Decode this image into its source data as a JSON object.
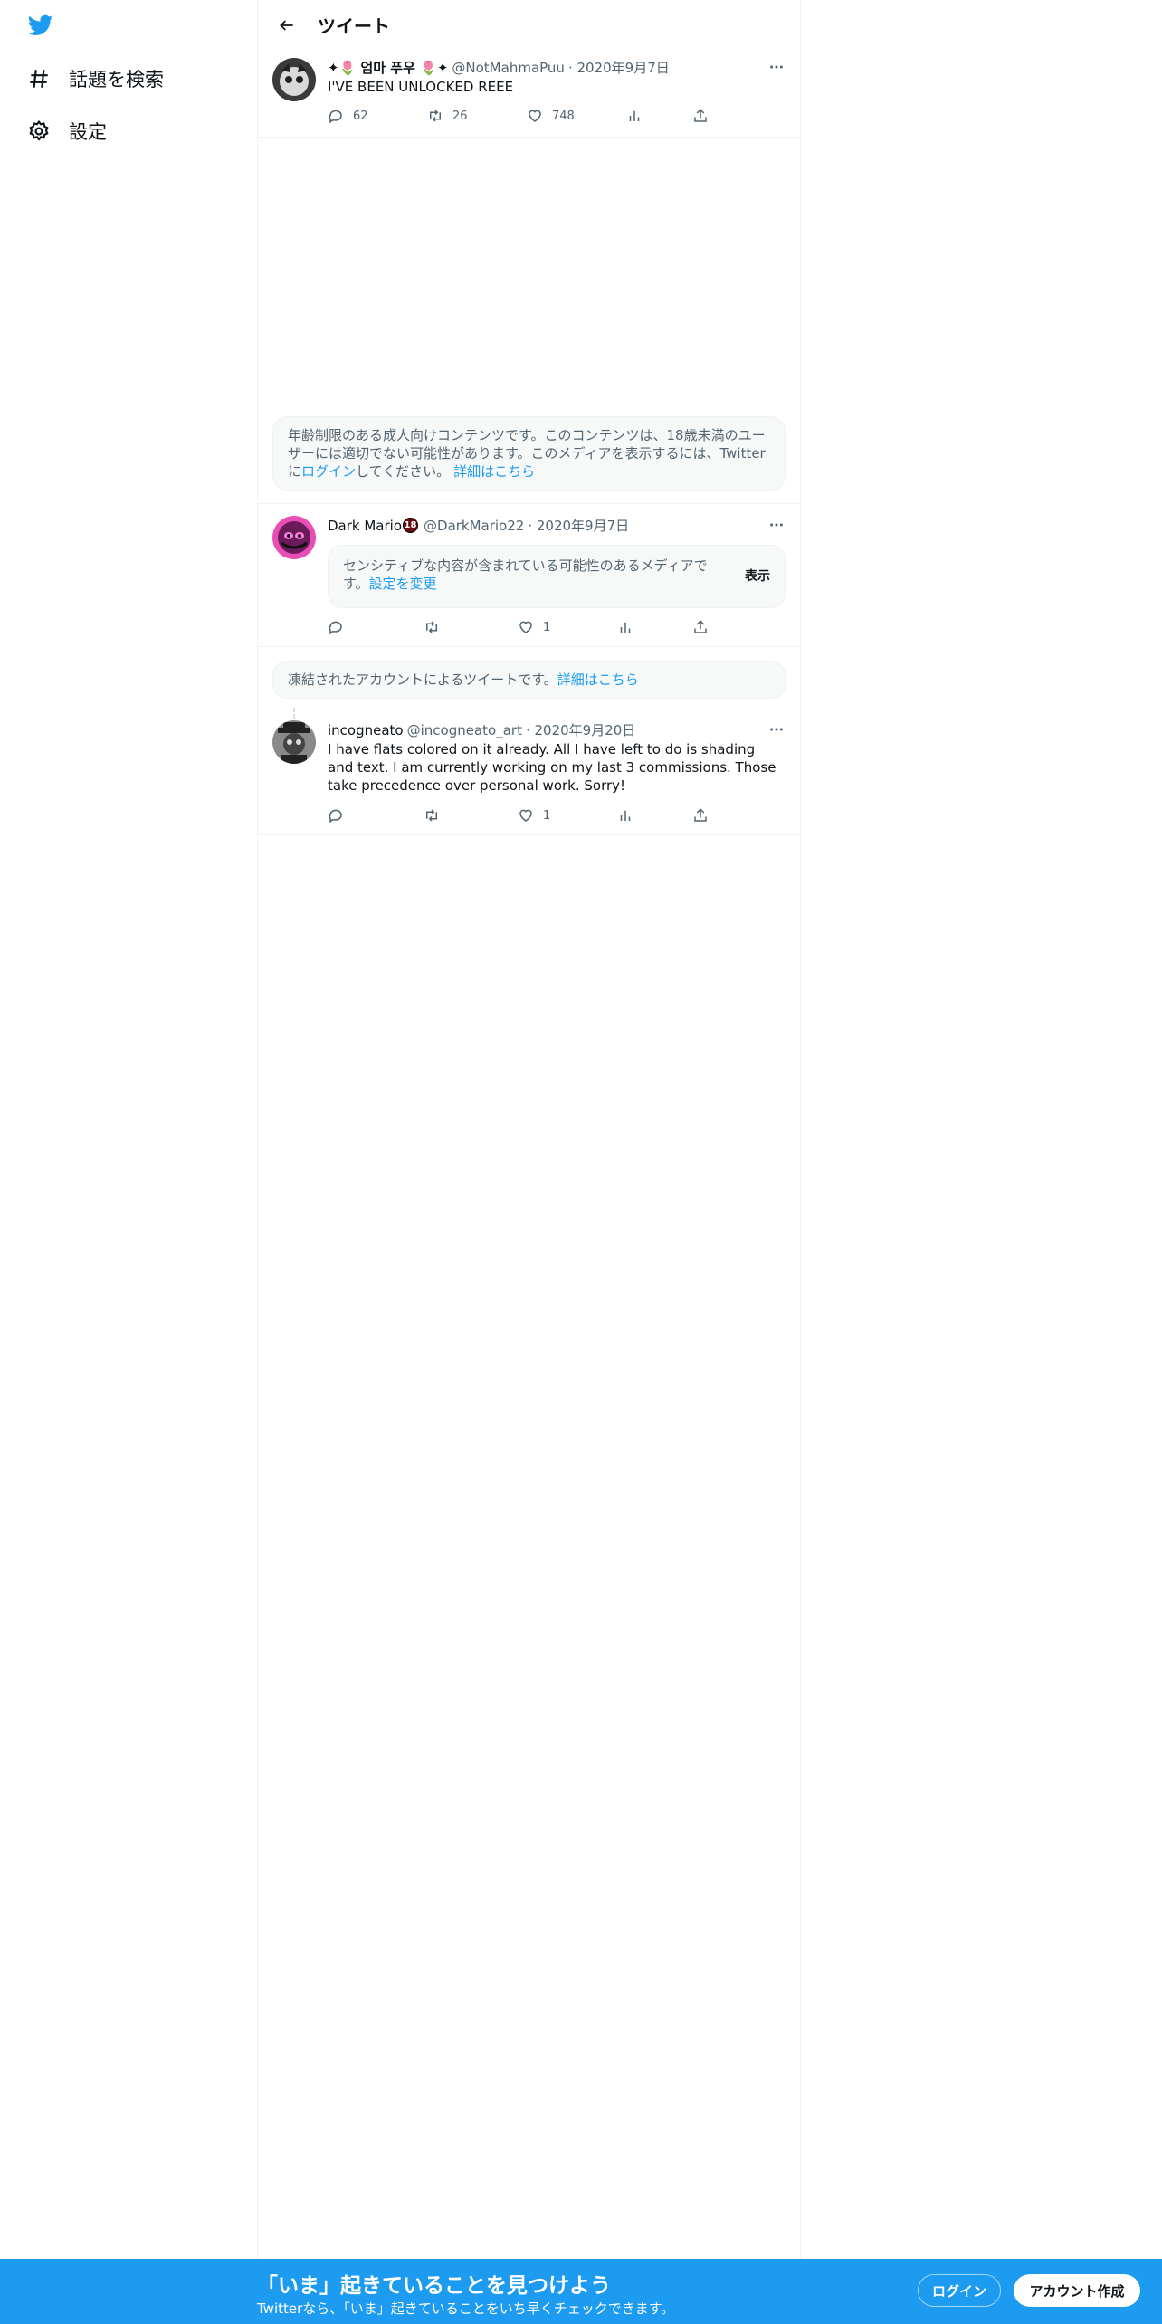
{
  "colors": {
    "brand": "#1d9bf0",
    "text": "#0f1419",
    "secondary": "#536471",
    "border": "#eff3f4"
  },
  "sidebar": {
    "logo_icon": "twitter-bird-icon",
    "items": [
      {
        "label": "話題を検索",
        "icon": "hashtag-icon"
      },
      {
        "label": "設定",
        "icon": "gear-icon"
      }
    ]
  },
  "header": {
    "title": "ツイート",
    "back_icon": "back-arrow-icon"
  },
  "tweets": [
    {
      "name_prefix": "✦🌷",
      "name": "엄마 푸우",
      "name_suffix": "🌷✦",
      "handle": "@NotMahmaPuu",
      "date": "· 2020年9月7日",
      "text": "I'VE BEEN UNLOCKED REEE",
      "replies": "62",
      "retweets": "26",
      "likes": "748"
    },
    {
      "name": "Dark Mario",
      "badge": "18",
      "handle": "@DarkMario22",
      "date": "· 2020年9月7日",
      "replies": "",
      "retweets": "",
      "likes": "1"
    },
    {
      "name": "incogneato",
      "handle": "@incogneato_art",
      "date": "· 2020年9月20日",
      "text": "I have flats colored on it already. All I have left to do is shading and text. I am currently working on my last 3 commissions. Those take precedence over personal work. Sorry!",
      "replies": "",
      "retweets": "",
      "likes": "1"
    }
  ],
  "age_notice": {
    "text_a": "年齢制限のある成人向けコンテンツです。このコンテンツは、18歳未満のユーザーには適切でない可能性があります。このメディアを表示するには、Twitterに",
    "login_link": "ログイン",
    "text_b": "してください。",
    "learn_more": "詳細はこちら"
  },
  "sensitive": {
    "text": "センシティブな内容が含まれている可能性のあるメディアです。",
    "settings_link": "設定を変更",
    "show_label": "表示"
  },
  "suspended": {
    "text": "凍結されたアカウントによるツイートです。",
    "learn_more": "詳細はこちら"
  },
  "bottom_bar": {
    "title": "「いま」起きていることを見つけよう",
    "subtitle": "Twitterなら、「いま」起きていることをいち早くチェックできます。",
    "login_label": "ログイン",
    "signup_label": "アカウント作成"
  }
}
